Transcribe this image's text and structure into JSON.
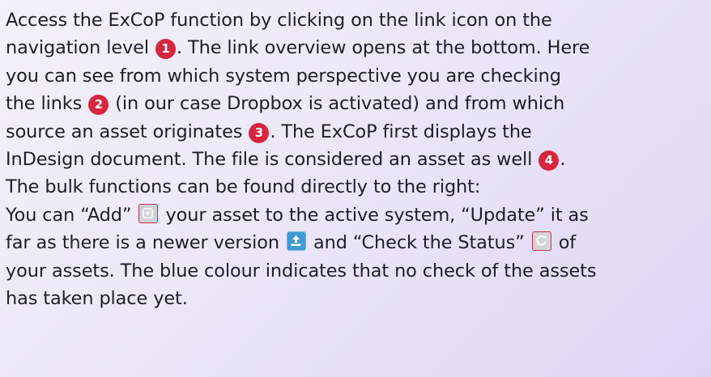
{
  "paragraph": {
    "l1": "Access the ExCoP function by clicking on the link icon on the",
    "l2a": "navigation level",
    "l2b": ". The link overview opens at the bottom. Here",
    "l3": "you can see from which system perspective you are checking",
    "l4a": "the links",
    "l4b": "(in our case Dropbox is activated) and from which",
    "l5a": "source an asset originates",
    "l5b": ". The ExCoP first displays the",
    "l6a": "InDesign document. The file is considered an asset as well",
    "l6b": ".",
    "l7": "The bulk functions can be found directly to the right:",
    "l8a": "You can “Add”",
    "l8b": "your asset to the active system, “Update” it as",
    "l9a": "far as there is a newer version",
    "l9b": "and “Check the Status”",
    "l9c": "of",
    "l10": "your assets. The blue colour indicates that no check of the assets",
    "l11": "has taken place yet."
  },
  "badges": {
    "b1": "1",
    "b2": "2",
    "b3": "3",
    "b4": "4",
    "color": "#d7263d"
  },
  "icons": {
    "add": "add-icon",
    "update": "update-icon",
    "status": "check-status-icon",
    "update_color": "#3f9ad6"
  }
}
